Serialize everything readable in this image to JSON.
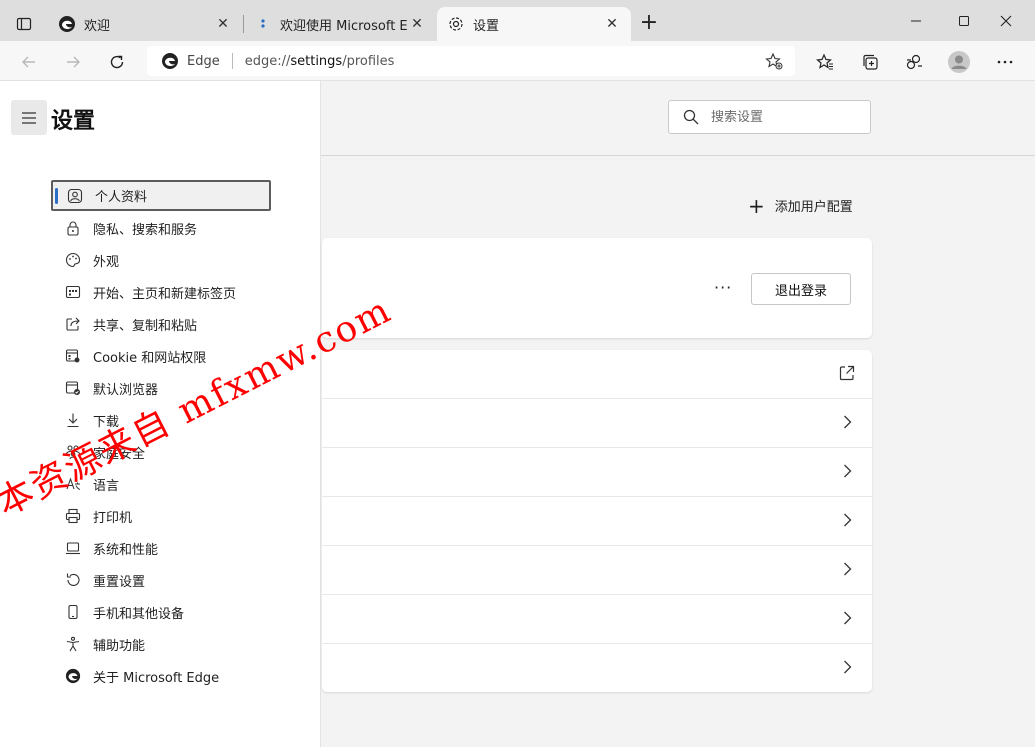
{
  "tabs": [
    {
      "title": "欢迎",
      "icon": "edge-icon",
      "active": false
    },
    {
      "title": "欢迎使用 Microsoft Edge",
      "icon": "edge-dev-icon",
      "active": false
    },
    {
      "title": "设置",
      "icon": "gear-icon",
      "active": true
    }
  ],
  "address_bar": {
    "site_label": "Edge",
    "url_prefix": "edge://",
    "url_host": "settings",
    "url_path": "/profiles"
  },
  "settings": {
    "title": "设置",
    "search_placeholder": "搜索设置",
    "add_profile_label": "添加用户配置",
    "logout_label": "退出登录",
    "more_label": "···"
  },
  "sidebar": {
    "items": [
      {
        "label": "个人资料",
        "icon": "profile-icon",
        "selected": true
      },
      {
        "label": "隐私、搜索和服务",
        "icon": "lock-icon"
      },
      {
        "label": "外观",
        "icon": "palette-icon"
      },
      {
        "label": "开始、主页和新建标签页",
        "icon": "start-page-icon"
      },
      {
        "label": "共享、复制和粘贴",
        "icon": "share-icon"
      },
      {
        "label": "Cookie 和网站权限",
        "icon": "site-permissions-icon"
      },
      {
        "label": "默认浏览器",
        "icon": "default-browser-icon"
      },
      {
        "label": "下载",
        "icon": "download-icon"
      },
      {
        "label": "家庭安全",
        "icon": "family-icon"
      },
      {
        "label": "语言",
        "icon": "language-icon"
      },
      {
        "label": "打印机",
        "icon": "printer-icon"
      },
      {
        "label": "系统和性能",
        "icon": "laptop-icon"
      },
      {
        "label": "重置设置",
        "icon": "reset-icon"
      },
      {
        "label": "手机和其他设备",
        "icon": "phone-icon"
      },
      {
        "label": "辅助功能",
        "icon": "accessibility-icon"
      },
      {
        "label": "关于 Microsoft Edge",
        "icon": "edge-icon"
      }
    ]
  },
  "watermark": "本资源来自 mfxmw.com",
  "colors": {
    "accent": "#2b6cc4",
    "watermark": "#ff0000"
  }
}
